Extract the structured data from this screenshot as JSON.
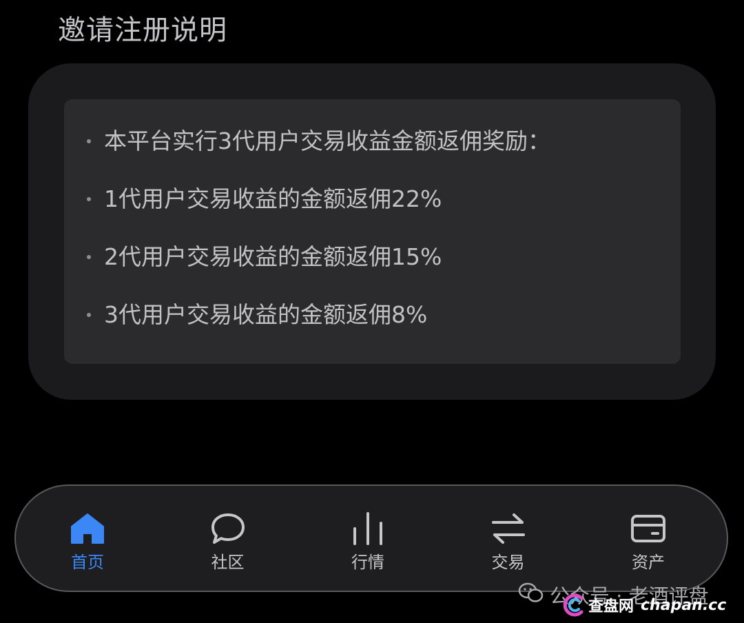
{
  "header": {
    "title": "邀请注册说明"
  },
  "rules": [
    "本平台实行3代用户交易收益金额返佣奖励：",
    "1代用户交易收益的金额返佣22%",
    "2代用户交易收益的金额返佣15%",
    "3代用户交易收益的金额返佣8%"
  ],
  "tabbar": {
    "active_color": "#3a87f5",
    "items": [
      {
        "label": "首页",
        "icon": "home-icon",
        "active": true
      },
      {
        "label": "社区",
        "icon": "chat-bubble-icon",
        "active": false
      },
      {
        "label": "行情",
        "icon": "bar-chart-icon",
        "active": false
      },
      {
        "label": "交易",
        "icon": "swap-arrows-icon",
        "active": false
      },
      {
        "label": "资产",
        "icon": "wallet-card-icon",
        "active": false
      }
    ]
  },
  "watermark": {
    "text": "公众号 · 老酒评盘",
    "brand_cn": "查盘网",
    "brand_en": "chapan.cc"
  }
}
